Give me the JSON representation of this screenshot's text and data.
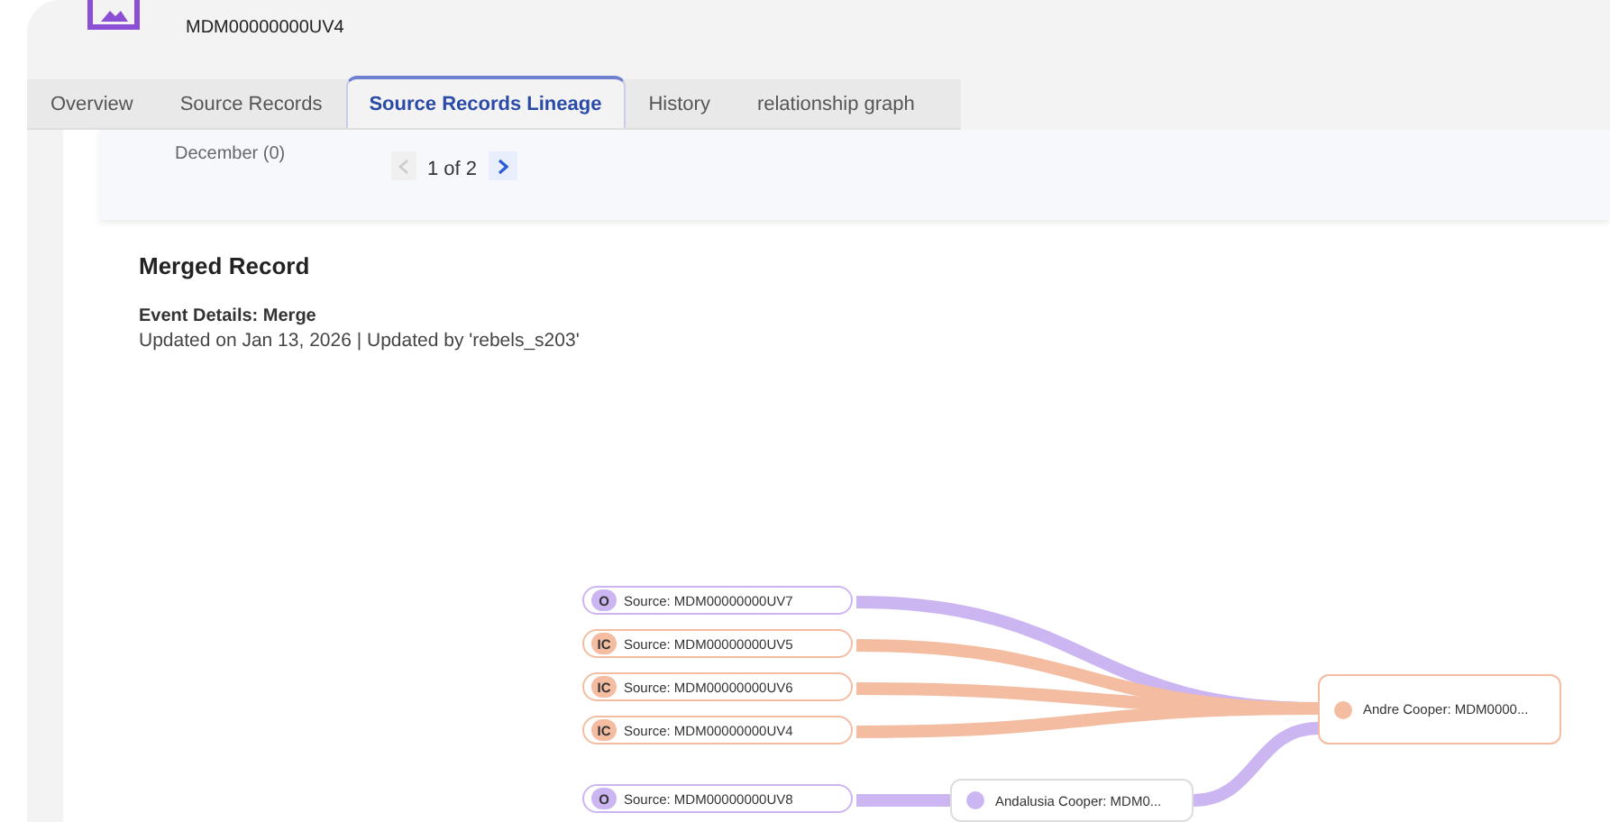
{
  "record": {
    "id": "MDM00000000UV4"
  },
  "tabs": [
    {
      "label": "Overview",
      "selected": false
    },
    {
      "label": "Source Records",
      "selected": false
    },
    {
      "label": "Source Records Lineage",
      "selected": true
    },
    {
      "label": "History",
      "selected": false
    },
    {
      "label": "relationship graph",
      "selected": false
    }
  ],
  "timeline": {
    "month": "December (0)",
    "pager": "1 of 2"
  },
  "event": {
    "title": "Merged Record",
    "details": "Event Details: Merge",
    "updated": "Updated on Jan 13, 2026 | Updated by 'rebels_s203'"
  },
  "lineage": {
    "result": {
      "label": "Andre Cooper: MDM0000...",
      "color": "#f4bca0",
      "inputs": [
        {
          "kind": "source",
          "badge": "O",
          "label": "Source: MDM00000000UV7",
          "color": "#cbb6f2"
        },
        {
          "kind": "source",
          "badge": "IC",
          "label": "Source: MDM00000000UV5",
          "color": "#f4bca0"
        },
        {
          "kind": "source",
          "badge": "IC",
          "label": "Source: MDM00000000UV6",
          "color": "#f4bca0"
        },
        {
          "kind": "source",
          "badge": "IC",
          "label": "Source: MDM00000000UV4",
          "color": "#f4bca0"
        },
        {
          "kind": "record",
          "label": "Andalusia Cooper: MDM0...",
          "color": "#cbb6f2",
          "inputs": [
            {
              "kind": "source",
              "badge": "O",
              "label": "Source: MDM00000000UV8",
              "color": "#cbb6f2"
            }
          ]
        }
      ]
    }
  }
}
